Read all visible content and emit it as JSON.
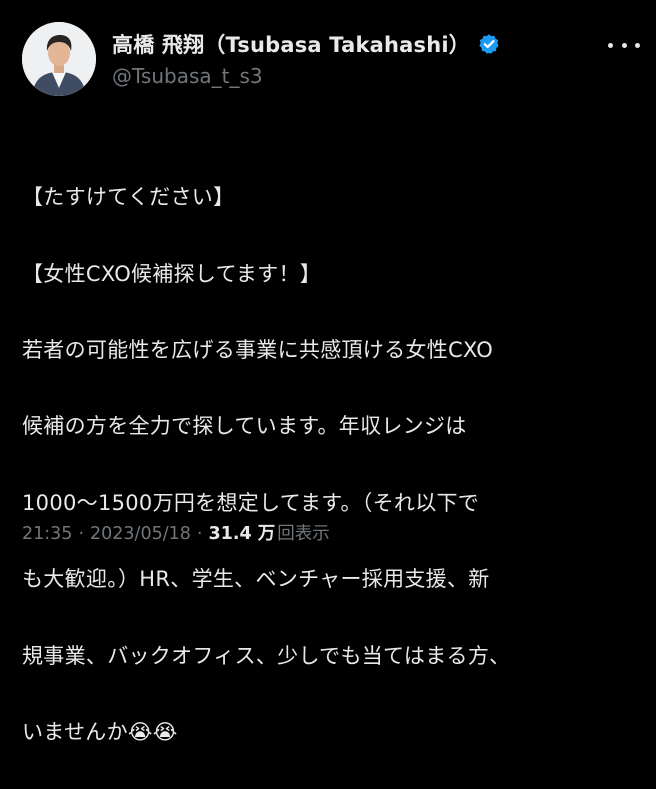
{
  "tweet": {
    "author": {
      "display_name": "高橋 飛翔（Tsubasa Takahashi）",
      "handle": "@Tsubasa_t_s3",
      "verified": true,
      "verified_color": "#1d9bf0"
    },
    "text_lines": [
      "【たすけてください】",
      "【女性CXO候補探してます！】",
      "若者の可能性を広げる事業に共感頂ける女性CXO",
      "候補の方を全力で探しています。年収レンジは",
      "1000～1500万円を想定してます。（それ以下で",
      "も大歓迎。）HR、学生、ベンチャー採用支援、新",
      "規事業、バックオフィス、少しでも当てはまる方、",
      "いませんか😭😭"
    ],
    "meta": {
      "time": "21:35",
      "separator": "·",
      "date": "2023/05/18",
      "views_count": "31.4 万",
      "views_label": "回表示"
    }
  },
  "colors": {
    "background": "#000000",
    "primary_text": "#e7e9ea",
    "secondary_text": "#71767b",
    "accent": "#1d9bf0"
  },
  "icons": {
    "avatar": "profile-photo",
    "verified": "verified-badge-icon",
    "more": "more-dots-icon"
  }
}
